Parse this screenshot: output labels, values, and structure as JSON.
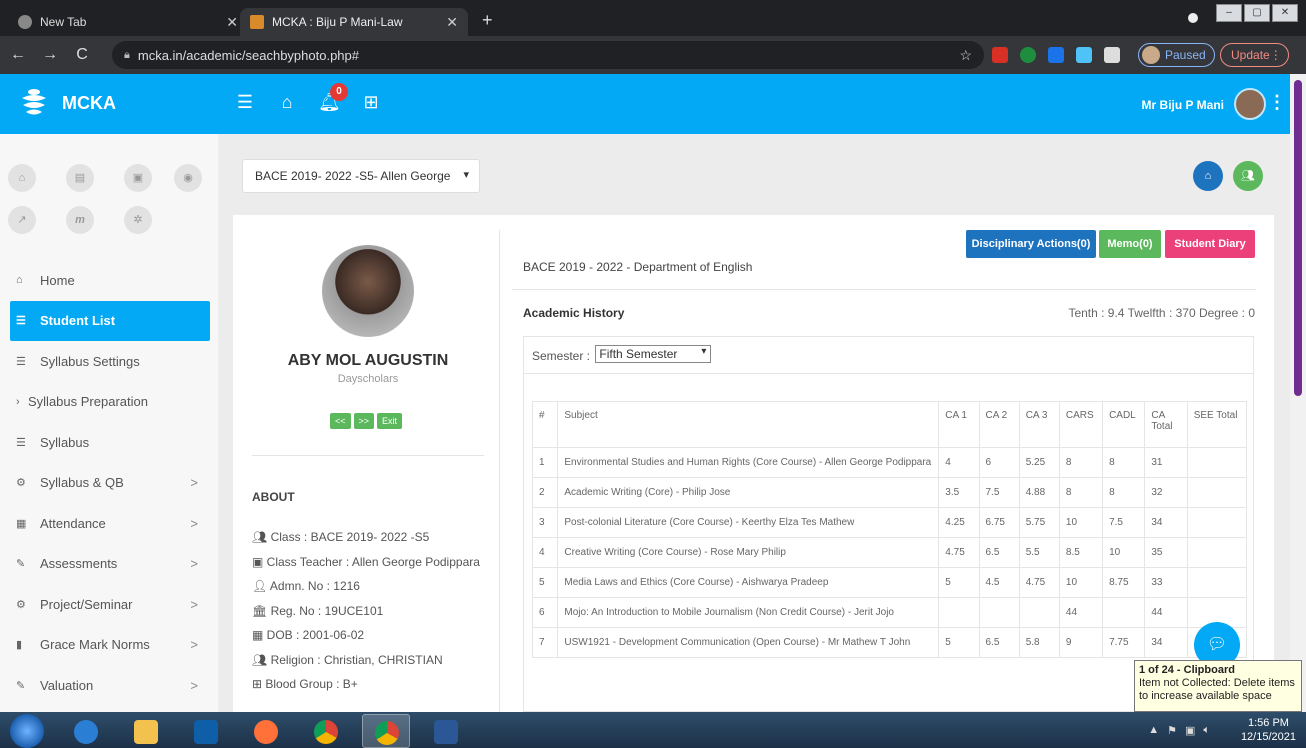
{
  "browser": {
    "tabs": [
      {
        "title": "New Tab"
      },
      {
        "title": "MCKA : Biju P Mani-Law"
      }
    ],
    "url": "mcka.in/academic/seachbyphoto.php#",
    "profile_status": "Paused",
    "update_label": "Update"
  },
  "header": {
    "brand": "MCKA",
    "notification_count": "0",
    "user_name": "Mr Biju P Mani"
  },
  "sidebar": {
    "items": [
      {
        "label": "Home",
        "icon": "home-icon",
        "chevron": ""
      },
      {
        "label": "Student List",
        "icon": "list-icon",
        "chevron": ""
      },
      {
        "label": "Syllabus Settings",
        "icon": "list-icon",
        "chevron": ""
      },
      {
        "label": "Syllabus Preparation",
        "icon": "chevron-right-icon",
        "chevron": ""
      },
      {
        "label": "Syllabus",
        "icon": "list-icon",
        "chevron": ""
      },
      {
        "label": "Syllabus & QB",
        "icon": "cogs-icon",
        "chevron": ">"
      },
      {
        "label": "Attendance",
        "icon": "calendar-icon",
        "chevron": ">"
      },
      {
        "label": "Assessments",
        "icon": "pencil-icon",
        "chevron": ">"
      },
      {
        "label": "Project/Seminar",
        "icon": "cogs-icon",
        "chevron": ">"
      },
      {
        "label": "Grace Mark Norms",
        "icon": "book-icon",
        "chevron": ">"
      },
      {
        "label": "Valuation",
        "icon": "pencil-icon",
        "chevron": ">"
      }
    ]
  },
  "main": {
    "batch_select": "BACE 2019- 2022 -S5- Allen George",
    "student": {
      "name": "ABY MOL AUGUSTIN",
      "type": "Dayscholars",
      "prev": "<<",
      "next": ">>",
      "exit": "Exit"
    },
    "about_title": "ABOUT",
    "about": {
      "class": "Class : BACE 2019- 2022 -S5",
      "teacher": "Class Teacher : Allen George Podippara",
      "admn": "Admn. No : 1216",
      "reg": "Reg. No : 19UCE101",
      "dob": "DOB : 2001-06-02",
      "religion": "Religion : Christian, CHRISTIAN",
      "blood": "Blood Group : B+"
    },
    "buttons": {
      "disciplinary": "Disciplinary Actions(0)",
      "memo": "Memo(0)",
      "diary": "Student Diary"
    },
    "department": "BACE 2019 - 2022 - Department of English",
    "academic_history": "Academic History",
    "marks_summary": "Tenth : 9.4 Twelfth : 370 Degree : 0",
    "semester_label": "Semester :",
    "semester_value": "Fifth Semester",
    "table": {
      "headers": [
        "#",
        "Subject",
        "CA 1",
        "CA 2",
        "CA 3",
        "CARS",
        "CADL",
        "CA Total",
        "SEE Total"
      ],
      "rows": [
        [
          "1",
          "Environmental Studies and Human Rights (Core Course) - Allen George Podippara",
          "4",
          "6",
          "5.25",
          "8",
          "8",
          "31",
          ""
        ],
        [
          "2",
          "Academic Writing (Core) - Philip Jose",
          "3.5",
          "7.5",
          "4.88",
          "8",
          "8",
          "32",
          ""
        ],
        [
          "3",
          "Post-colonial Literature (Core Course) - Keerthy Elza Tes Mathew",
          "4.25",
          "6.75",
          "5.75",
          "10",
          "7.5",
          "34",
          ""
        ],
        [
          "4",
          "Creative Writing (Core Course) - Rose Mary Philip",
          "4.75",
          "6.5",
          "5.5",
          "8.5",
          "10",
          "35",
          ""
        ],
        [
          "5",
          "Media Laws and Ethics (Core Course) - Aishwarya Pradeep",
          "5",
          "4.5",
          "4.75",
          "10",
          "8.75",
          "33",
          ""
        ],
        [
          "6",
          "Mojo: An Introduction to Mobile Journalism (Non Credit Course) - Jerit Jojo",
          "",
          "",
          "",
          "44",
          "",
          "44",
          ""
        ],
        [
          "7",
          "USW1921 - Development Communication (Open Course) - Mr Mathew T John",
          "5",
          "6.5",
          "5.8",
          "9",
          "7.75",
          "34",
          ""
        ]
      ]
    }
  },
  "clipboard_tooltip": {
    "title": "1 of 24 - Clipboard",
    "body": "Item not Collected: Delete items to increase available space"
  },
  "taskbar": {
    "time": "1:56 PM",
    "date": "12/15/2021"
  },
  "colors": {
    "primary": "#03a9f4",
    "disciplinary": "#1e73be",
    "memo": "#5cb85c",
    "diary": "#ec407a"
  }
}
